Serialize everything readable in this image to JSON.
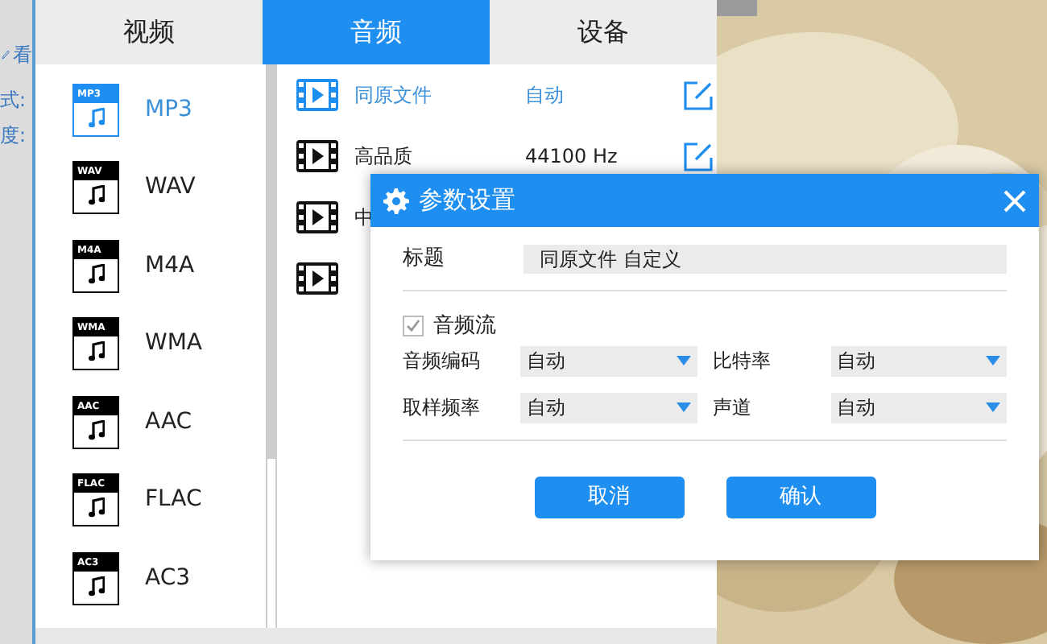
{
  "side_strip": {
    "labels": [
      "看",
      "式:",
      "度:"
    ]
  },
  "tabs": [
    {
      "label": "视频",
      "selected": false
    },
    {
      "label": "音频",
      "selected": true
    },
    {
      "label": "设备",
      "selected": false
    }
  ],
  "formats": [
    {
      "tag": "MP3",
      "label": "MP3",
      "selected": true
    },
    {
      "tag": "WAV",
      "label": "WAV",
      "selected": false
    },
    {
      "tag": "M4A",
      "label": "M4A",
      "selected": false
    },
    {
      "tag": "WMA",
      "label": "WMA",
      "selected": false
    },
    {
      "tag": "AAC",
      "label": "AAC",
      "selected": false
    },
    {
      "tag": "FLAC",
      "label": "FLAC",
      "selected": false
    },
    {
      "tag": "AC3",
      "label": "AC3",
      "selected": false
    }
  ],
  "presets": [
    {
      "name": "同原文件",
      "value": "自动",
      "selected": true
    },
    {
      "name": "高品质",
      "value": "44100 Hz",
      "selected": false
    },
    {
      "name": "中",
      "selected": false
    },
    {
      "selected": false
    }
  ],
  "dialog": {
    "title": "参数设置",
    "title_label": "标题",
    "title_value": "同原文件 自定义",
    "audio_stream": {
      "label": "音频流",
      "checked": true,
      "disabled": true
    },
    "fields": [
      {
        "label": "音频编码",
        "value": "自动"
      },
      {
        "label": "比特率",
        "value": "自动"
      },
      {
        "label": "取样频率",
        "value": "自动"
      },
      {
        "label": "声道",
        "value": "自动"
      }
    ],
    "buttons": [
      "取消",
      "确认"
    ]
  }
}
